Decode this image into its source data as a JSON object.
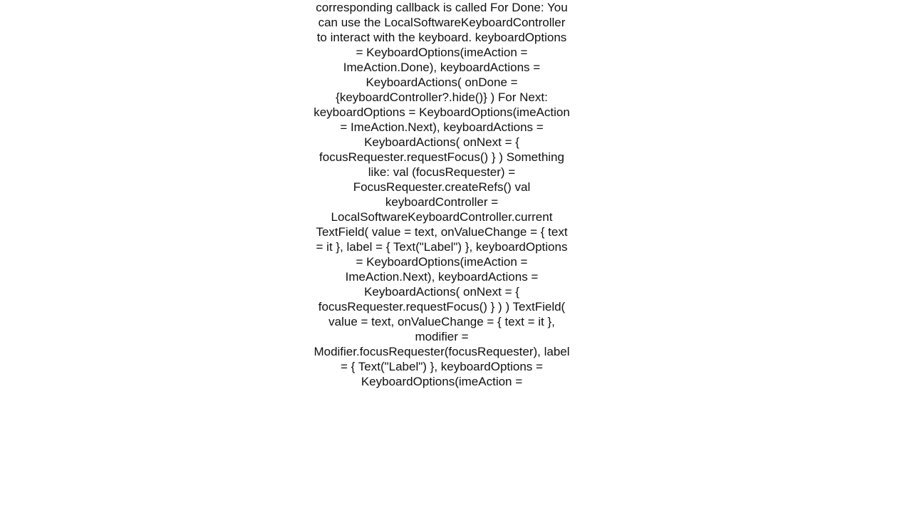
{
  "body": "corresponding callback is called  For Done: You can use the LocalSoftwareKeyboardController to interact with the keyboard. keyboardOptions = KeyboardOptions(imeAction = ImeAction.Done), keyboardActions = KeyboardActions(     onDone = {keyboardController?.hide()} )  For Next: keyboardOptions = KeyboardOptions(imeAction = ImeAction.Next), keyboardActions = KeyboardActions(     onNext = { focusRequester.requestFocus() } ) Something like: val (focusRequester) = FocusRequester.createRefs() val keyboardController = LocalSoftwareKeyboardController.current  TextField(     value = text,     onValueChange = {         text = it     },     label = { Text(\"Label\") },     keyboardOptions = KeyboardOptions(imeAction = ImeAction.Next),     keyboardActions = KeyboardActions(         onNext = { focusRequester.requestFocus() }      ) )  TextField(     value = text,     onValueChange = {         text = it     },     modifier = Modifier.focusRequester(focusRequester),     label = { Text(\"Label\") },     keyboardOptions = KeyboardOptions(imeAction ="
}
